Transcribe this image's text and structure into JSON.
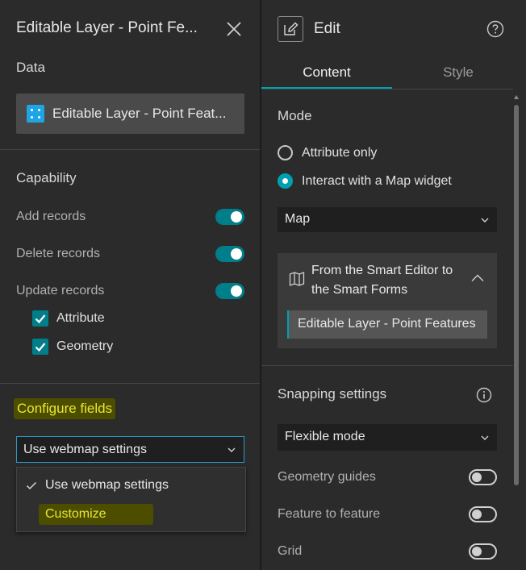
{
  "left_panel": {
    "title": "Editable Layer - Point Fe...",
    "close_icon": "close-icon",
    "data_label": "Data",
    "data_source": {
      "icon": "point-layer-icon",
      "text": "Editable Layer - Point Feat..."
    },
    "capability": {
      "label": "Capability",
      "add_records": "Add records",
      "delete_records": "Delete records",
      "update_records": "Update records",
      "attribute": "Attribute",
      "geometry": "Geometry"
    },
    "configure_fields": {
      "label": "Configure fields",
      "selected_value": "Use webmap settings",
      "options": [
        "Use webmap settings",
        "Customize"
      ]
    }
  },
  "right_panel": {
    "title": "Edit",
    "help_icon": "help-icon",
    "tabs": {
      "content": "Content",
      "style": "Style"
    },
    "mode": {
      "label": "Mode",
      "attribute_only": "Attribute only",
      "interact_map": "Interact with a Map widget",
      "map_select": "Map"
    },
    "map_card": {
      "title": "From the Smart Editor to the Smart Forms",
      "layer_item": "Editable Layer - Point Features"
    },
    "snapping": {
      "label": "Snapping settings",
      "mode_select": "Flexible mode",
      "geometry_guides": "Geometry guides",
      "feature_to_feature": "Feature to feature",
      "grid": "Grid"
    }
  },
  "colors": {
    "background": "#2b2b2b",
    "accent": "#007e8a",
    "highlight_bg": "#4d4d00",
    "highlight_text": "#e8e834",
    "layer_icon": "#1ea5e6"
  }
}
